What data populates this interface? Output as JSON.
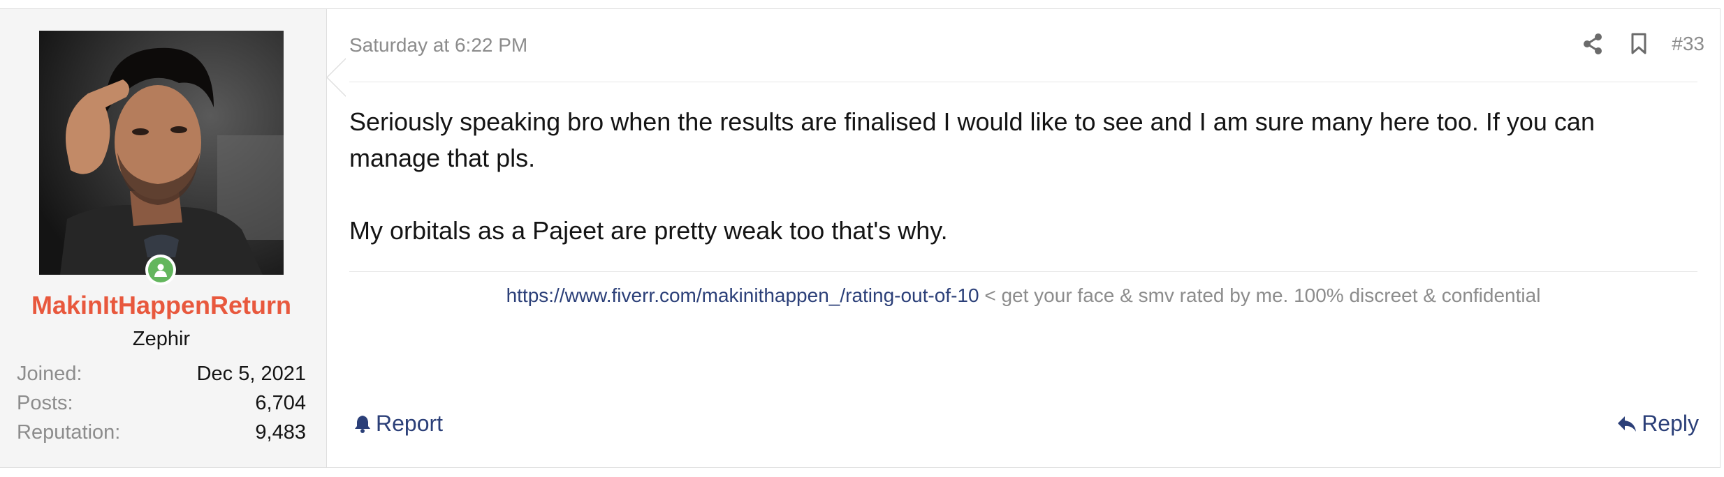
{
  "user": {
    "username": "MakinItHappenReturn",
    "title": "Zephir",
    "stats": [
      {
        "label": "Joined:",
        "value": "Dec 5, 2021"
      },
      {
        "label": "Posts:",
        "value": "6,704"
      },
      {
        "label": "Reputation:",
        "value": "9,483"
      }
    ],
    "online": true
  },
  "post": {
    "date": "Saturday at 6:22 PM",
    "number": "#33",
    "paragraphs": [
      "Seriously speaking bro when the results are finalised I would like to see and I am sure many here too. If you can manage that pls.",
      "My orbitals as a Pajeet are pretty weak too that's why."
    ]
  },
  "signature": {
    "link": "https://www.fiverr.com/makinithappen_/rating-out-of-10",
    "text": " < get your face & smv rated by me. 100% discreet & confidential"
  },
  "actions": {
    "report_label": "Report",
    "reply_label": "Reply"
  },
  "icons": {
    "share": "share-icon",
    "bookmark": "bookmark-icon",
    "online": "online-status-icon",
    "report": "bell-icon",
    "reply": "reply-arrow-icon"
  },
  "colors": {
    "username": "#e8583d",
    "link": "#2b3f78",
    "muted": "#8c8c8c",
    "online": "#63b65d"
  }
}
